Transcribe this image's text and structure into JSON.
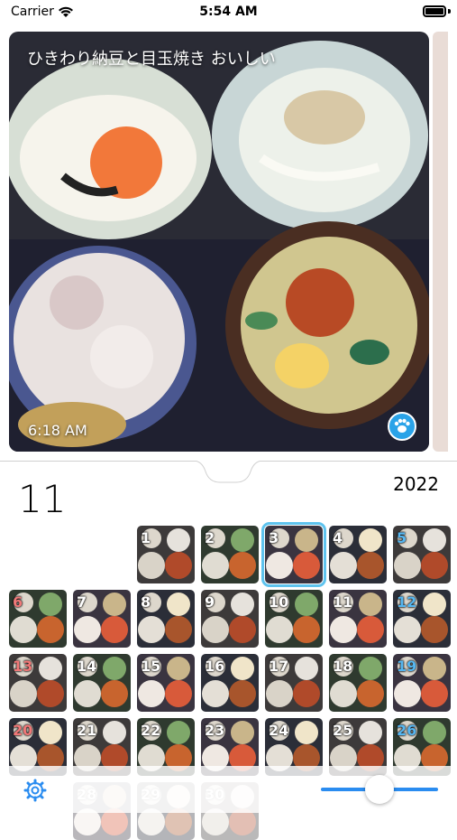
{
  "status_bar": {
    "carrier": "Carrier",
    "time": "5:54 AM"
  },
  "hero": {
    "caption": "ひきわり納豆と目玉焼き おいしい",
    "time": "6:18 AM",
    "paw_icon": "paw-icon"
  },
  "calendar": {
    "month": "11",
    "year": "2022",
    "selected_day": 3,
    "accent_color": "#5ec3ee",
    "saturday_color": "#56b6f0",
    "sunday_color": "#f07878",
    "days": [
      {
        "d": "1",
        "dow": "tue"
      },
      {
        "d": "2",
        "dow": "wed"
      },
      {
        "d": "3",
        "dow": "thu"
      },
      {
        "d": "4",
        "dow": "fri"
      },
      {
        "d": "5",
        "dow": "sat"
      },
      {
        "d": "6",
        "dow": "sun"
      },
      {
        "d": "7",
        "dow": "mon"
      },
      {
        "d": "8",
        "dow": "tue"
      },
      {
        "d": "9",
        "dow": "wed"
      },
      {
        "d": "10",
        "dow": "thu"
      },
      {
        "d": "11",
        "dow": "fri"
      },
      {
        "d": "12",
        "dow": "sat"
      },
      {
        "d": "13",
        "dow": "sun"
      },
      {
        "d": "14",
        "dow": "mon"
      },
      {
        "d": "15",
        "dow": "tue"
      },
      {
        "d": "16",
        "dow": "wed"
      },
      {
        "d": "17",
        "dow": "thu"
      },
      {
        "d": "18",
        "dow": "fri"
      },
      {
        "d": "19",
        "dow": "sat"
      },
      {
        "d": "20",
        "dow": "sun"
      },
      {
        "d": "21",
        "dow": "mon"
      },
      {
        "d": "22",
        "dow": "tue"
      },
      {
        "d": "23",
        "dow": "wed"
      },
      {
        "d": "24",
        "dow": "thu"
      },
      {
        "d": "25",
        "dow": "fri"
      },
      {
        "d": "26",
        "dow": "sat"
      },
      {
        "d": "28",
        "dow": "mon"
      },
      {
        "d": "29",
        "dow": "tue"
      },
      {
        "d": "30",
        "dow": "wed"
      }
    ]
  },
  "toolbar": {
    "settings_icon": "gear-icon",
    "slider_value": 0.5
  }
}
